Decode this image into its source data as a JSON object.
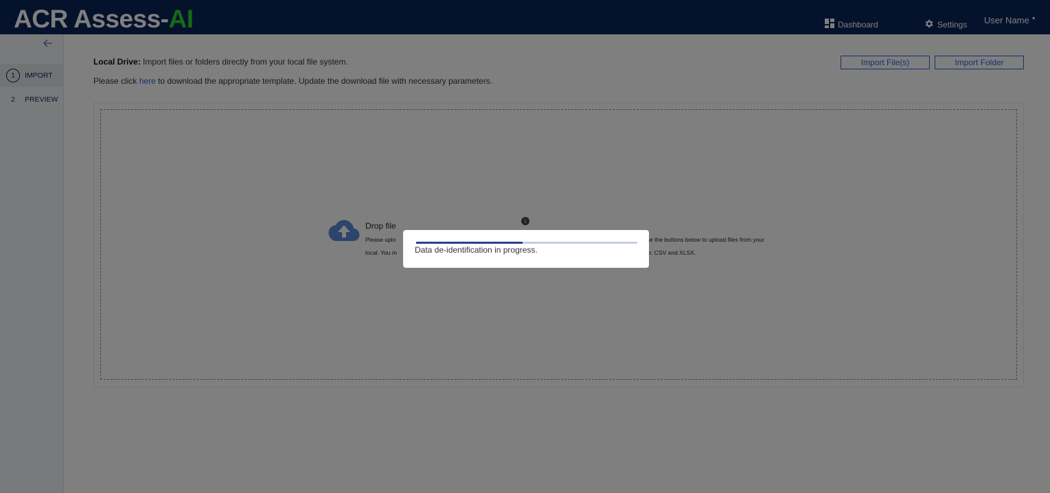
{
  "header": {
    "logo_main": "ACR Assess-",
    "logo_accent": "AI",
    "accent_color": "#2fd233",
    "bar_color": "#0a2458",
    "nav": {
      "dashboard_label": "Dashboard",
      "dashboard_icon": "dashboard-icon",
      "settings_label": "Settings",
      "settings_icon": "gear-icon"
    },
    "user_name": "User Name"
  },
  "sidebar": {
    "back_icon": "arrow-left-icon",
    "steps": [
      {
        "number": "1",
        "label": "IMPORT",
        "active": true
      },
      {
        "number": "2",
        "label": "PREVIEW",
        "active": false
      }
    ]
  },
  "main": {
    "intro_bold": "Local Drive:",
    "intro_text": " Import files or folders directly from your local file system.",
    "template_prefix": "Please click ",
    "template_link": "here",
    "template_suffix": " to download the appropriate template. Update the download file with necessary parameters.",
    "import_files_label": "Import File(s)",
    "import_folder_label": "Import Folder",
    "drop_zone": {
      "icon": "cloud-upload-icon",
      "title": "Drop file",
      "info_icon": "info-icon",
      "desc_line1_start": "Please uplo",
      "desc_line1_end": "r use the buttons below to upload files from your",
      "desc_line2_start": "local. You m",
      "desc_line2_end": "lude: CSV and XLSX."
    }
  },
  "modal": {
    "message": "Data de-identification in progress.",
    "progress_fraction": 0.48
  }
}
